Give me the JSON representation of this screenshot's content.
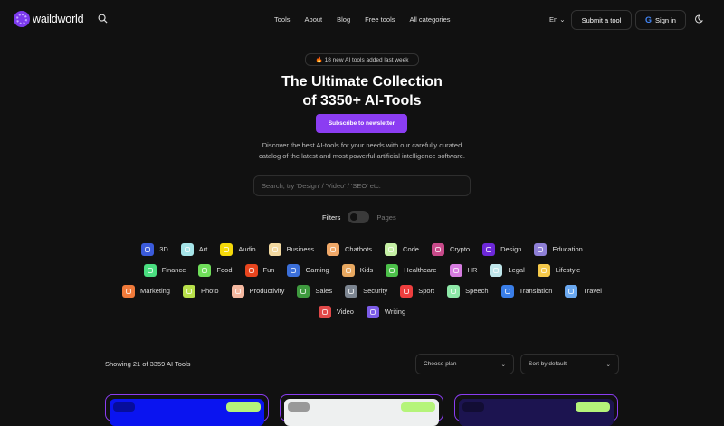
{
  "brand": {
    "name": "waildworld"
  },
  "nav": {
    "links": [
      "Tools",
      "About",
      "Blog",
      "Free tools",
      "All categories"
    ],
    "lang": "En",
    "submit": "Submit a tool",
    "signin": "Sign in",
    "google_g": "G"
  },
  "hero": {
    "badge": "18 new AI tools added last week",
    "title_line1": "The Ultimate Collection",
    "title_line2": "of 3350+ AI-Tools",
    "subscribe": "Subscribe to newsletter",
    "desc_line1": "Discover the best AI-tools for your needs with our carefully curated",
    "desc_line2": "catalog of the latest and most powerful artificial intelligence software.",
    "search_placeholder": "Search, try 'Design' / 'Video' / 'SEO' etc.",
    "filters": "Filters",
    "pages": "Pages"
  },
  "categories": [
    [
      {
        "label": "3D",
        "color": "#3b5bdb"
      },
      {
        "label": "Art",
        "color": "#a5e4e8"
      },
      {
        "label": "Audio",
        "color": "#f5d90a"
      },
      {
        "label": "Business",
        "color": "#f3d9a0"
      },
      {
        "label": "Chatbots",
        "color": "#f0a868"
      },
      {
        "label": "Code",
        "color": "#c5f0a4"
      },
      {
        "label": "Crypto",
        "color": "#c84a8a"
      },
      {
        "label": "Design",
        "color": "#6d28d9"
      },
      {
        "label": "Education",
        "color": "#8e7fd6"
      }
    ],
    [
      {
        "label": "Finance",
        "color": "#4ade80"
      },
      {
        "label": "Food",
        "color": "#6fde5a"
      },
      {
        "label": "Fun",
        "color": "#e8451e"
      },
      {
        "label": "Gaming",
        "color": "#3b6fd9"
      },
      {
        "label": "Kids",
        "color": "#e8a860"
      },
      {
        "label": "Healthcare",
        "color": "#4cc04a"
      },
      {
        "label": "HR",
        "color": "#d67ce0"
      },
      {
        "label": "Legal",
        "color": "#bfe6ea"
      },
      {
        "label": "Lifestyle",
        "color": "#f5c94a"
      }
    ],
    [
      {
        "label": "Marketing",
        "color": "#f07a3a"
      },
      {
        "label": "Photo",
        "color": "#b8e04a"
      },
      {
        "label": "Productivity",
        "color": "#f5b8a0"
      },
      {
        "label": "Sales",
        "color": "#3f9a3f"
      },
      {
        "label": "Security",
        "color": "#7c8591"
      },
      {
        "label": "Sport",
        "color": "#ee3e3e"
      },
      {
        "label": "Speech",
        "color": "#8ee8a8"
      },
      {
        "label": "Translation",
        "color": "#3a7ee8"
      },
      {
        "label": "Travel",
        "color": "#6aa8f0"
      }
    ],
    [
      {
        "label": "Video",
        "color": "#e04848"
      },
      {
        "label": "Writing",
        "color": "#7c5ce8"
      }
    ]
  ],
  "listing": {
    "showing": "Showing 21 of 3359 AI Tools",
    "plan": "Choose plan",
    "sort": "Sort by default"
  },
  "cards": [
    {
      "bg": "#0a14f0"
    },
    {
      "bg": "#eef0f0"
    },
    {
      "bg": "#1c1450"
    }
  ],
  "colors": {
    "accent": "#8b3df2",
    "bg": "#111111"
  }
}
